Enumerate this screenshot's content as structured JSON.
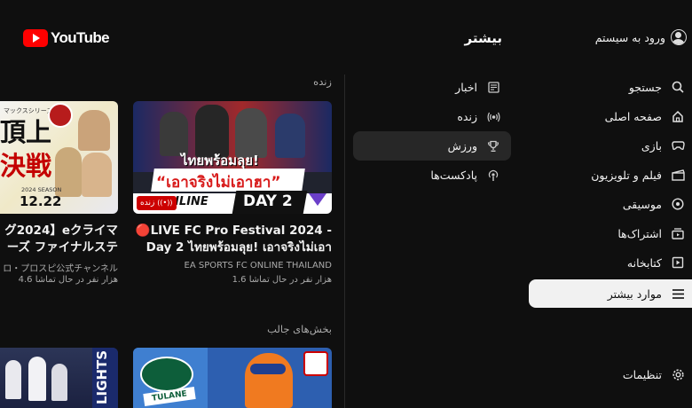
{
  "header": {
    "logo_text": "YouTube",
    "title": "بیشتر",
    "signin_label": "ورود به سیستم"
  },
  "nav": {
    "items": [
      {
        "label": "جستجو",
        "icon": "search-icon"
      },
      {
        "label": "صفحه اصلی",
        "icon": "home-icon"
      },
      {
        "label": "بازی",
        "icon": "gamepad-icon"
      },
      {
        "label": "فیلم و تلویزیون",
        "icon": "film-icon"
      },
      {
        "label": "موسیقی",
        "icon": "music-icon"
      },
      {
        "label": "اشتراک‌ها",
        "icon": "subscriptions-icon"
      },
      {
        "label": "کتابخانه",
        "icon": "library-icon"
      },
      {
        "label": "موارد بیشتر",
        "icon": "menu-icon"
      }
    ],
    "active_index": 7,
    "settings_label": "تنظیمات"
  },
  "submenu": {
    "items": [
      {
        "label": "اخبار",
        "icon": "news-icon"
      },
      {
        "label": "زنده",
        "icon": "live-icon"
      },
      {
        "label": "ورزش",
        "icon": "trophy-icon"
      },
      {
        "label": "پادکست‌ها",
        "icon": "podcast-icon"
      }
    ],
    "active_index": 2
  },
  "sections": {
    "live_label": "زنده",
    "featured_label": "بخش‌های جالب"
  },
  "videos": [
    {
      "title_line1": "🔴LIVE FC Pro Festival 2024 -",
      "title_line2": "Day 2 ไทยพร้อมลุย! เอาจริงไม่เอา",
      "channel": "EA SPORTS FC ONLINE THAILAND",
      "viewers": "1.6 هزار نفر در حال تماشا",
      "live_badge": "زنده",
      "thumb_text1": "ไทยพร้อมลุย!",
      "thumb_text2": "“เอาจริงไม่เอาฮา”",
      "thumb_bottom_left": "ONLINE",
      "thumb_bottom_right": "DAY 2"
    },
    {
      "title_line1": "グ2024】eクライマ",
      "title_line2": "ーズ ファイナルステ",
      "channel": "ロ・プロスピ公式チャンネル",
      "viewers": "4.6 هزار نفر در حال تماشا",
      "thumb_text1": "頂上",
      "thumb_text2": "決戦",
      "thumb_date": "12.22",
      "thumb_season": "2024 SEASON"
    }
  ],
  "featured": [
    {
      "thumb_text": "LIGHTS"
    },
    {
      "thumb_text": "TULANE"
    }
  ],
  "colors": {
    "background": "#0f0f0f",
    "accent_red": "#ff0000",
    "active_nav_bg": "#f1f1f1",
    "active_sub_bg": "#272727",
    "muted_text": "#aaaaaa"
  }
}
